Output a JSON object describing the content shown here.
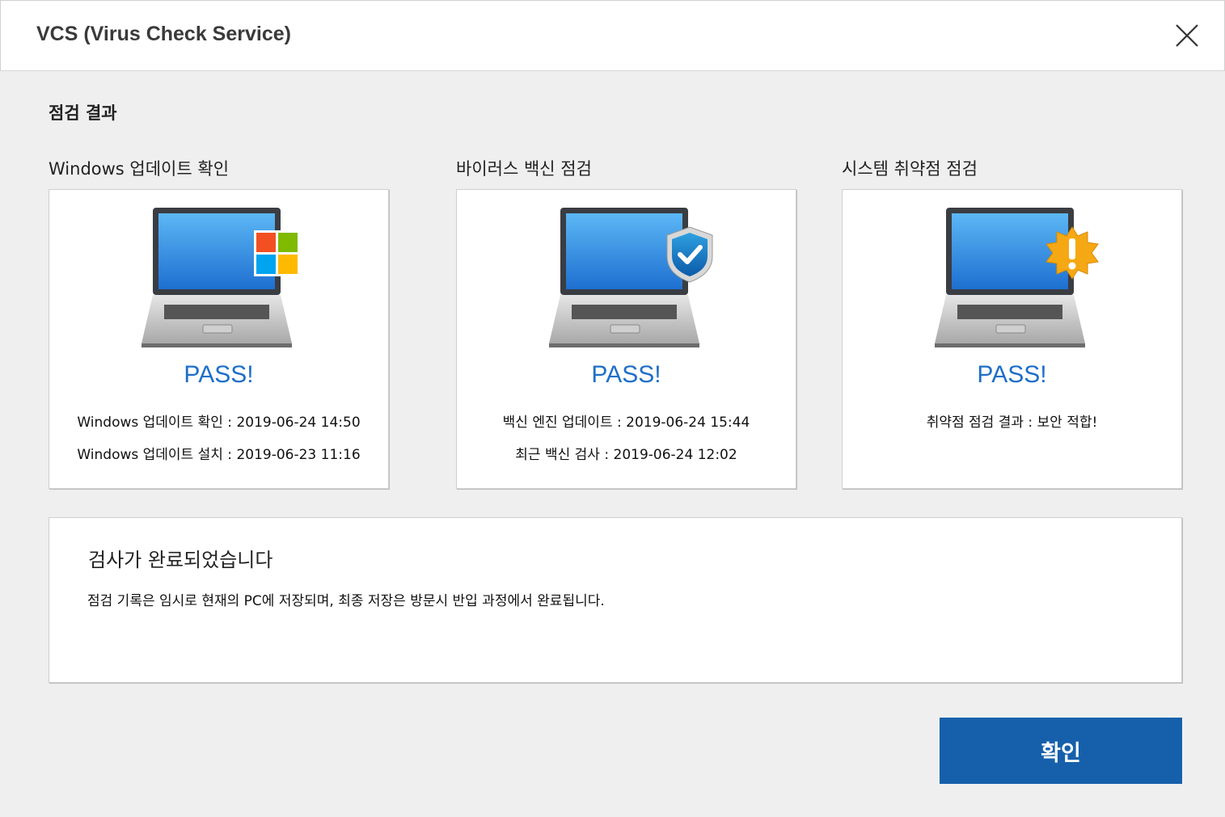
{
  "window": {
    "title": "VCS (Virus Check Service)"
  },
  "section_title": "점검 결과",
  "checks": [
    {
      "label": "Windows 업데이트 확인",
      "badge_icon": "windows-logo-icon",
      "status": "PASS!",
      "lines": [
        {
          "key": "Windows 업데이트 확인",
          "value": "2019-06-24 14:50"
        },
        {
          "key": "Windows 업데이트 설치",
          "value": "2019-06-23 11:16"
        }
      ]
    },
    {
      "label": "바이러스 백신 점검",
      "badge_icon": "shield-check-icon",
      "status": "PASS!",
      "lines": [
        {
          "key": "백신 엔진 업데이트",
          "value": "2019-06-24 15:44"
        },
        {
          "key": "최근 백신 검사",
          "value": "2019-06-24 12:02"
        }
      ]
    },
    {
      "label": "시스템 취약점 점검",
      "badge_icon": "warning-burst-icon",
      "status": "PASS!",
      "lines": [
        {
          "key": "취약점 점검 결과",
          "value": "보안 적합!"
        }
      ]
    }
  ],
  "message": {
    "title": "검사가 완료되었습니다",
    "body": "점검 기록은 임시로 현재의 PC에 저장되며, 최종 저장은 방문시 반입 과정에서 완료됩니다."
  },
  "buttons": {
    "ok": "확인"
  },
  "colors": {
    "pass": "#1e6fc8",
    "button": "#1660ab",
    "background": "#efefef"
  }
}
